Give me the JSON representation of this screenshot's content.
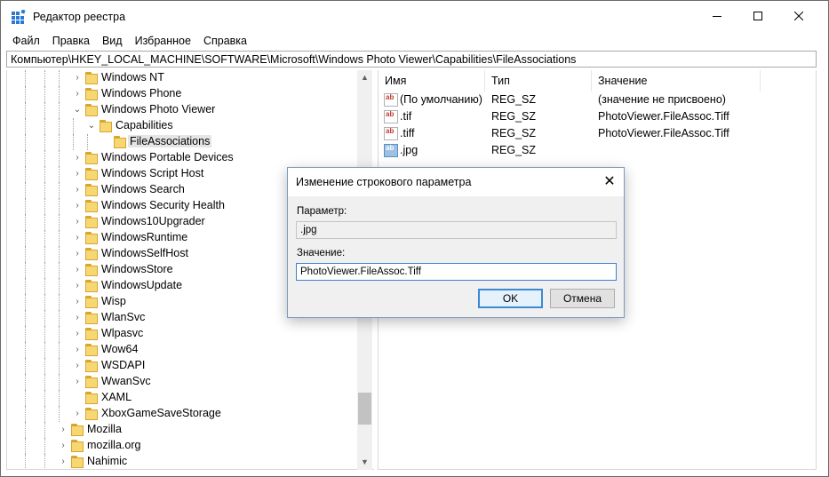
{
  "window": {
    "title": "Редактор реестра",
    "icon": "regedit-icon",
    "controls": {
      "minimize": "minimize-icon",
      "maximize": "maximize-icon",
      "close": "close-icon"
    }
  },
  "menu": [
    "Файл",
    "Правка",
    "Вид",
    "Избранное",
    "Справка"
  ],
  "address": "Компьютер\\HKEY_LOCAL_MACHINE\\SOFTWARE\\Microsoft\\Windows Photo Viewer\\Capabilities\\FileAssociations",
  "tree": {
    "items": [
      {
        "label": "Windows NT",
        "arrow": "›"
      },
      {
        "label": "Windows Phone",
        "arrow": "›"
      },
      {
        "label": "Windows Photo Viewer",
        "arrow": "⌄"
      },
      {
        "label": "Capabilities",
        "arrow": "⌄"
      },
      {
        "label": "FileAssociations",
        "arrow": ""
      },
      {
        "label": "Windows Portable Devices",
        "arrow": "›"
      },
      {
        "label": "Windows Script Host",
        "arrow": "›"
      },
      {
        "label": "Windows Search",
        "arrow": "›"
      },
      {
        "label": "Windows Security Health",
        "arrow": "›"
      },
      {
        "label": "Windows10Upgrader",
        "arrow": "›"
      },
      {
        "label": "WindowsRuntime",
        "arrow": "›"
      },
      {
        "label": "WindowsSelfHost",
        "arrow": "›"
      },
      {
        "label": "WindowsStore",
        "arrow": "›"
      },
      {
        "label": "WindowsUpdate",
        "arrow": "›"
      },
      {
        "label": "Wisp",
        "arrow": "›"
      },
      {
        "label": "WlanSvc",
        "arrow": "›"
      },
      {
        "label": "Wlpasvc",
        "arrow": "›"
      },
      {
        "label": "Wow64",
        "arrow": "›"
      },
      {
        "label": "WSDAPI",
        "arrow": "›"
      },
      {
        "label": "WwanSvc",
        "arrow": "›"
      },
      {
        "label": "XAML",
        "arrow": ""
      },
      {
        "label": "XboxGameSaveStorage",
        "arrow": "›"
      },
      {
        "label": "Mozilla",
        "arrow": "›"
      },
      {
        "label": "mozilla.org",
        "arrow": "›"
      },
      {
        "label": "Nahimic",
        "arrow": "›"
      }
    ],
    "selected": "FileAssociations"
  },
  "list": {
    "columns": [
      "Имя",
      "Тип",
      "Значение"
    ],
    "rows": [
      {
        "name": "(По умолчанию)",
        "type": "REG_SZ",
        "value": "(значение не присвоено)"
      },
      {
        "name": ".tif",
        "type": "REG_SZ",
        "value": "PhotoViewer.FileAssoc.Tiff"
      },
      {
        "name": ".tiff",
        "type": "REG_SZ",
        "value": "PhotoViewer.FileAssoc.Tiff"
      },
      {
        "name": ".jpg",
        "type": "REG_SZ",
        "value": ""
      }
    ],
    "value_icon_text": "ab"
  },
  "dialog": {
    "title": "Изменение строкового параметра",
    "param_label": "Параметр:",
    "param_value": ".jpg",
    "value_label": "Значение:",
    "value_value": "PhotoViewer.FileAssoc.Tiff",
    "ok": "OK",
    "cancel": "Отмена"
  }
}
